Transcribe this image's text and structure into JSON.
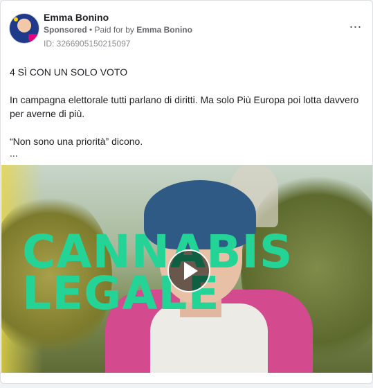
{
  "post": {
    "author": "Emma Bonino",
    "sponsored_label": "Sponsored",
    "paid_for_prefix": "• Paid for by",
    "advertiser": "Emma Bonino",
    "ad_id": "ID: 3266905150215097",
    "more_icon": "⋯"
  },
  "body": {
    "line1": "4 SÌ CON UN SOLO VOTO",
    "line2": "In campagna elettorale tutti parlano di diritti. Ma solo Più Europa poi lotta davvero per averne di più.",
    "line3": "“Non sono una priorità” dicono.",
    "ellipsis": "..."
  },
  "media": {
    "overlay_line1": "CANNABIS",
    "overlay_line2": "LEGALE",
    "overlay_color": "#23d496",
    "play_icon": "play-icon"
  }
}
